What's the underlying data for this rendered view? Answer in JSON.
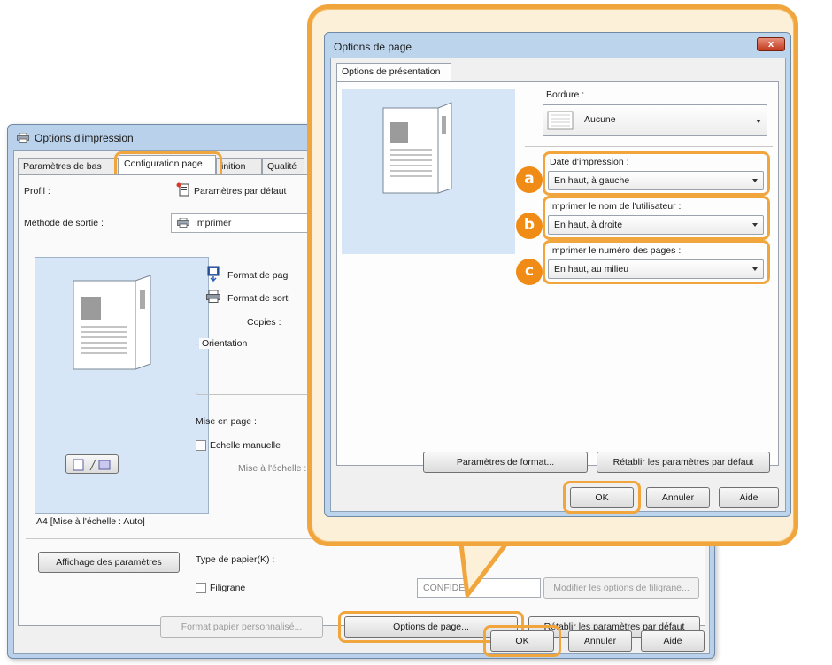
{
  "back_window": {
    "title": "Options d'impression",
    "tabs": [
      "Paramètres de bas",
      "Configuration page",
      "inition",
      "Qualité"
    ],
    "profile_label": "Profil :",
    "profile_value": "Paramètres par défaut",
    "output_label": "Méthode de sortie :",
    "output_value": "Imprimer",
    "page_format_label": "Format de pag",
    "output_format_label": "Format de sorti",
    "copies_label": "Copies :",
    "orientation_label": "Orientation",
    "layout_label": "Mise en page :",
    "manual_scale_label": "Echelle manuelle",
    "scale_label": "Mise à l'échelle :",
    "preview_caption": "A4 [Mise à l'échelle : Auto]",
    "show_settings_button": "Affichage des paramètres",
    "paper_type_label": "Type de papier(K) :",
    "watermark_label": "Filigrane",
    "watermark_value": "CONFIDE",
    "edit_watermark_button": "Modifier les options de filigrane...",
    "custom_paper_button": "Format papier personnalisé...",
    "page_options_button": "Options de page...",
    "restore_defaults_button": "Rétablir les paramètres par défaut",
    "ok_button": "OK",
    "cancel_button": "Annuler",
    "help_button": "Aide"
  },
  "front_dialog": {
    "title": "Options de page",
    "close_glyph": "x",
    "tab": "Options de présentation",
    "border_label": "Bordure :",
    "border_value": "Aucune",
    "print_date_label": "Date d'impression :",
    "print_date_value": "En haut, à gauche",
    "username_label": "Imprimer le nom de l'utilisateur :",
    "username_value": "En haut, à droite",
    "page_number_label": "Imprimer le numéro des pages :",
    "page_number_value": "En haut, au milieu",
    "format_settings_button": "Paramètres de format...",
    "restore_defaults_button": "Rétablir les paramètres par défaut",
    "ok_button": "OK",
    "cancel_button": "Annuler",
    "help_button": "Aide"
  },
  "badges": [
    "a",
    "b",
    "c"
  ],
  "colors": {
    "highlight": "#f0a63d",
    "badge": "#f08c16",
    "balloon_fill": "#fdf0d8",
    "window_frame": "#b9d1ea",
    "preview_fill": "#d7e6f7"
  }
}
